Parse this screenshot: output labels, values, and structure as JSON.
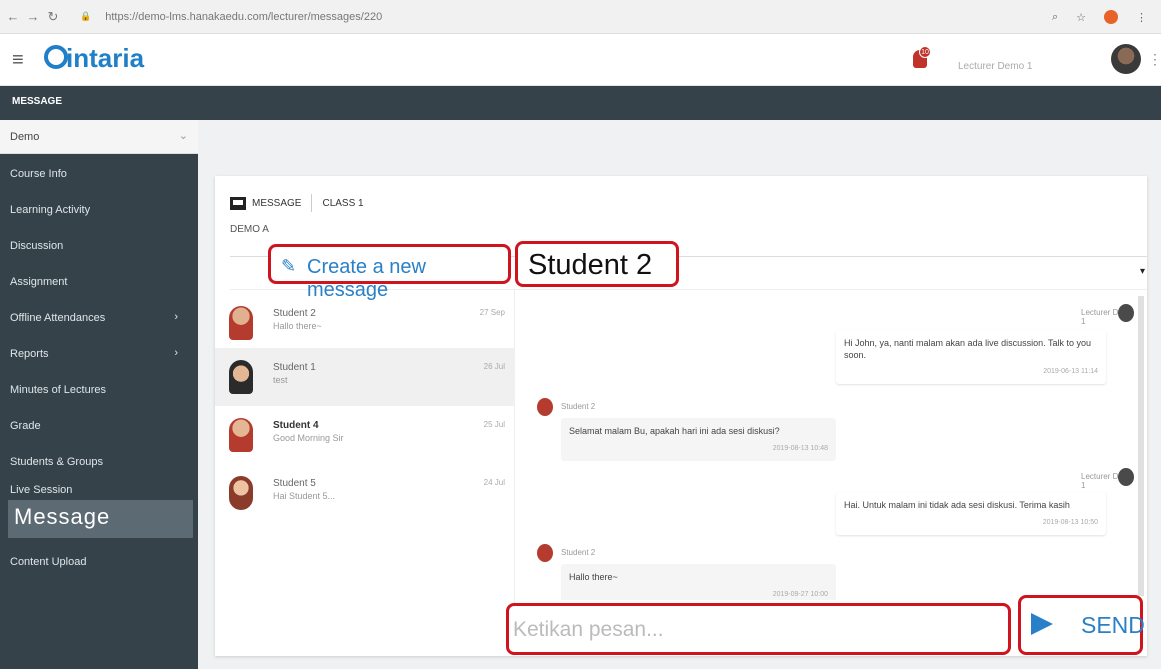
{
  "browser": {
    "url": "https://demo-lms.hanakaedu.com/lecturer/messages/220"
  },
  "app": {
    "logo": "intaria",
    "notif_count": "10",
    "user": "Lecturer Demo 1"
  },
  "page": {
    "section_title": "MESSAGE",
    "course_selected": "Demo"
  },
  "sidebar": {
    "items": [
      {
        "label": "Course Info"
      },
      {
        "label": "Learning Activity"
      },
      {
        "label": "Discussion"
      },
      {
        "label": "Assignment"
      },
      {
        "label": "Offline Attendances"
      },
      {
        "label": "Reports"
      },
      {
        "label": "Minutes of Lectures"
      },
      {
        "label": "Grade"
      },
      {
        "label": "Students & Groups"
      },
      {
        "label": "Live Session"
      },
      {
        "label": "Message"
      },
      {
        "label": "Content Upload"
      }
    ]
  },
  "card": {
    "tab_message": "MESSAGE",
    "tab_class": "CLASS 1",
    "class_name": "DEMO A"
  },
  "toolbar": {
    "create_label": "Create a new message",
    "current_recipient": "Student 2"
  },
  "conversations": [
    {
      "name": "Student 2",
      "preview": "Hallo there~",
      "date": "27 Sep"
    },
    {
      "name": "Student 1",
      "preview": "test",
      "date": "26 Jul"
    },
    {
      "name": "Student 4",
      "preview": "Good Morning Sir",
      "date": "25 Jul"
    },
    {
      "name": "Student 5",
      "preview": "Hai Student 5...",
      "date": "24 Jul"
    }
  ],
  "messages": [
    {
      "from": "Lecturer Demo 1",
      "text": "Hi John, ya, nanti malam akan ada live discussion. Talk to you soon.",
      "time": "2019-06-13 11:14"
    },
    {
      "from": "Student 2",
      "text": "Selamat malam Bu, apakah hari ini ada sesi diskusi?",
      "time": "2019-08-13 10:48"
    },
    {
      "from": "Lecturer Demo 1",
      "text": "Hai. Untuk malam ini tidak ada sesi diskusi. Terima kasih",
      "time": "2019-08-13 10:50"
    },
    {
      "from": "Student 2",
      "text": "Hallo there~",
      "time": "2019-09-27 10:00"
    }
  ],
  "composer": {
    "placeholder": "Ketikan pesan...",
    "send_label": "SEND"
  }
}
